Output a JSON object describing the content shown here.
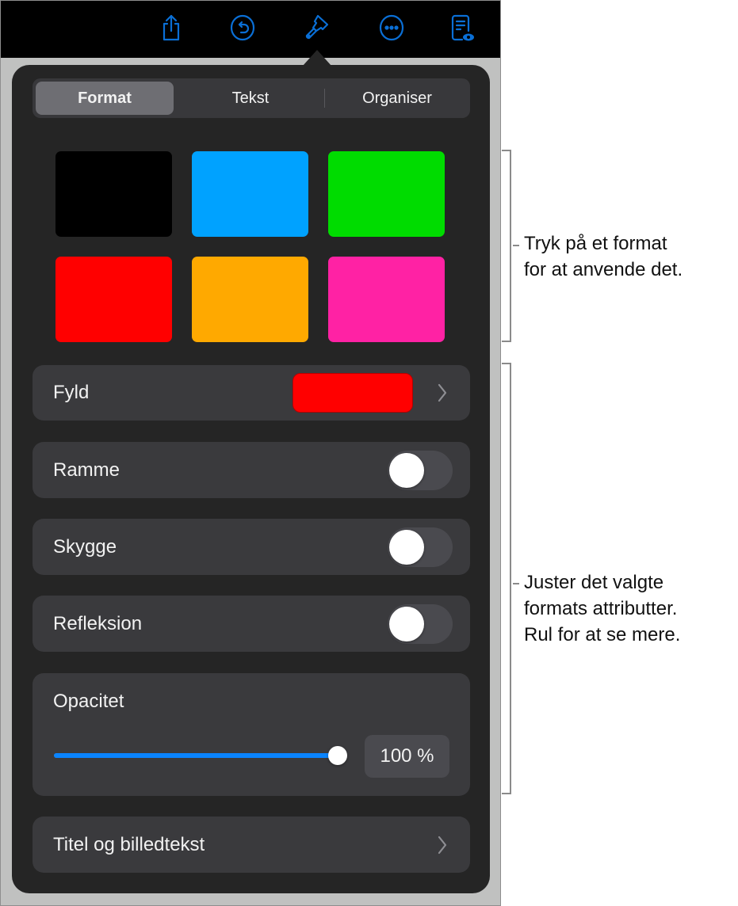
{
  "toolbar": {
    "icons": [
      {
        "name": "share-icon",
        "label": "Share"
      },
      {
        "name": "undo-icon",
        "label": "Undo"
      },
      {
        "name": "paintbrush-icon",
        "label": "Format"
      },
      {
        "name": "more-icon",
        "label": "More"
      },
      {
        "name": "document-view-icon",
        "label": "View document"
      }
    ],
    "accent_color": "#0a6fd6"
  },
  "tabs": [
    {
      "label": "Format",
      "active": true
    },
    {
      "label": "Tekst",
      "active": false
    },
    {
      "label": "Organiser",
      "active": false
    }
  ],
  "style_swatches": [
    {
      "color": "#000000"
    },
    {
      "color": "#00a2ff"
    },
    {
      "color": "#00dc00"
    },
    {
      "color": "#ff0000"
    },
    {
      "color": "#ffa900"
    },
    {
      "color": "#ff22a4"
    }
  ],
  "fill": {
    "label": "Fyld",
    "color": "#ff0000"
  },
  "toggles": [
    {
      "label": "Ramme",
      "on": false
    },
    {
      "label": "Skygge",
      "on": false
    },
    {
      "label": "Refleksion",
      "on": false
    }
  ],
  "opacity": {
    "label": "Opacitet",
    "value": 100,
    "display": "100 %"
  },
  "title_caption": {
    "label": "Titel og billedtekst"
  },
  "callouts": {
    "styles": [
      "Tryk på et format",
      "for at anvende det."
    ],
    "attributes": [
      "Juster det valgte",
      "formats attributter.",
      "Rul for at se mere."
    ]
  }
}
